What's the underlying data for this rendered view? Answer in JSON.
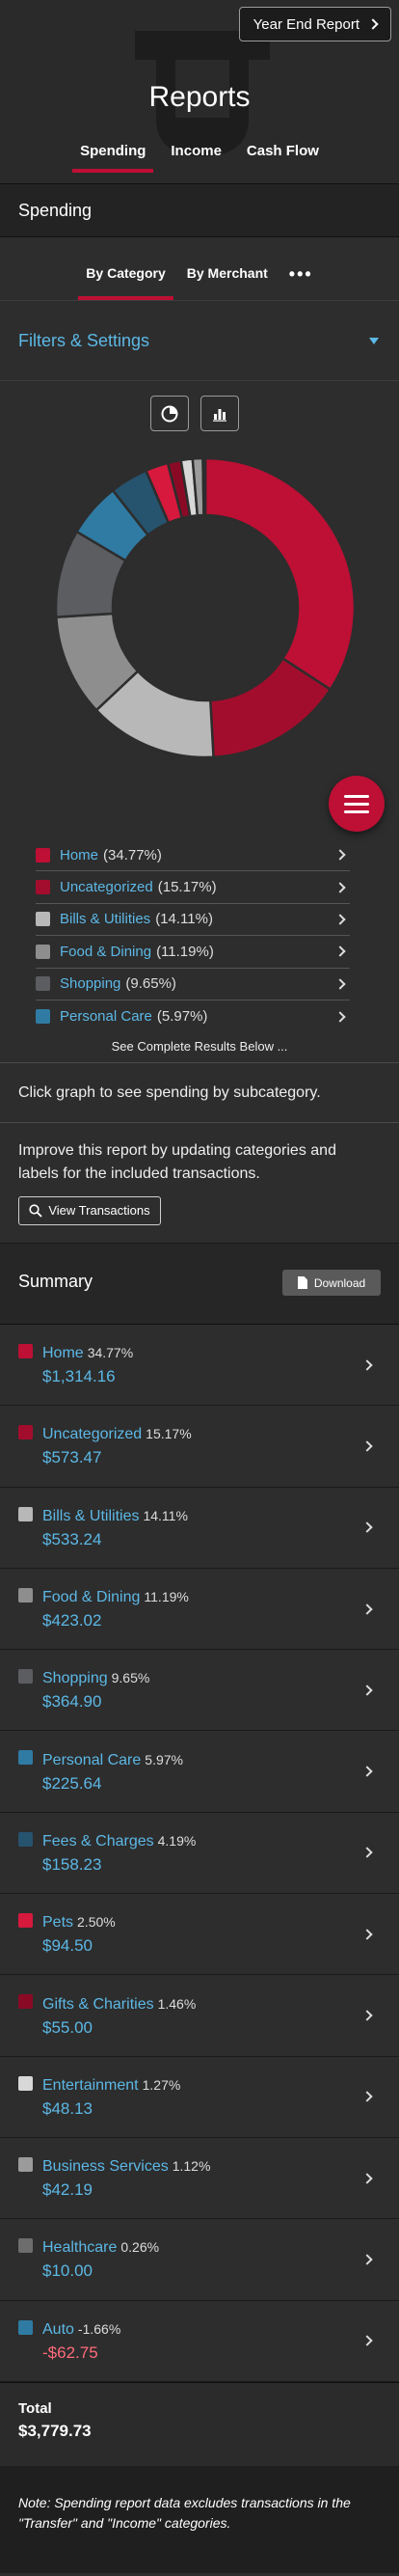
{
  "header": {
    "title": "Reports",
    "year_end_label": "Year End Report",
    "tabs": [
      {
        "label": "Spending",
        "active": true
      },
      {
        "label": "Income",
        "active": false
      },
      {
        "label": "Cash Flow",
        "active": false
      }
    ]
  },
  "spending_section": {
    "title": "Spending"
  },
  "subtabs": [
    {
      "label": "By Category",
      "active": true
    },
    {
      "label": "By Merchant",
      "active": false
    }
  ],
  "more_icon": "more-horizontal-icon",
  "filters": {
    "label": "Filters & Settings"
  },
  "chart_data": {
    "type": "pie",
    "categories": [
      "Home",
      "Uncategorized",
      "Bills & Utilities",
      "Food & Dining",
      "Shopping",
      "Personal Care",
      "Fees & Charges",
      "Pets",
      "Gifts & Charities",
      "Entertainment",
      "Business Services",
      "Healthcare"
    ],
    "values": [
      34.77,
      15.17,
      14.11,
      11.19,
      9.65,
      5.97,
      4.19,
      2.5,
      1.46,
      1.27,
      1.12,
      0.26
    ],
    "colors": [
      "#be0f34",
      "#a30d2d",
      "#b8b8b8",
      "#8e8e8e",
      "#5c5d61",
      "#2f7ba3",
      "#26536e",
      "#d6193d",
      "#8a0a26",
      "#d8d8d8",
      "#9b9b9b",
      "#6d6d6d"
    ]
  },
  "legend": [
    {
      "name": "Home",
      "pct": "(34.77%)",
      "color": "#be0f34"
    },
    {
      "name": "Uncategorized",
      "pct": "(15.17%)",
      "color": "#a30d2d"
    },
    {
      "name": "Bills & Utilities",
      "pct": "(14.11%)",
      "color": "#b8b8b8"
    },
    {
      "name": "Food & Dining",
      "pct": "(11.19%)",
      "color": "#8e8e8e"
    },
    {
      "name": "Shopping",
      "pct": "(9.65%)",
      "color": "#5c5d61"
    },
    {
      "name": "Personal Care",
      "pct": "(5.97%)",
      "color": "#2f7ba3"
    }
  ],
  "see_all": "See Complete Results Below ...",
  "click_hint": "Click graph to see spending by subcategory.",
  "improve_text": "Improve this report by updating categories and labels for the included transactions.",
  "view_transactions_label": "View Transactions",
  "summary": {
    "title": "Summary",
    "download_label": "Download",
    "rows": [
      {
        "name": "Home",
        "pct": "34.77%",
        "amount": "$1,314.16",
        "color": "#be0f34",
        "negative": false
      },
      {
        "name": "Uncategorized",
        "pct": "15.17%",
        "amount": "$573.47",
        "color": "#a30d2d",
        "negative": false
      },
      {
        "name": "Bills & Utilities",
        "pct": "14.11%",
        "amount": "$533.24",
        "color": "#b8b8b8",
        "negative": false
      },
      {
        "name": "Food & Dining",
        "pct": "11.19%",
        "amount": "$423.02",
        "color": "#8e8e8e",
        "negative": false
      },
      {
        "name": "Shopping",
        "pct": "9.65%",
        "amount": "$364.90",
        "color": "#5c5d61",
        "negative": false
      },
      {
        "name": "Personal Care",
        "pct": "5.97%",
        "amount": "$225.64",
        "color": "#2f7ba3",
        "negative": false
      },
      {
        "name": "Fees & Charges",
        "pct": "4.19%",
        "amount": "$158.23",
        "color": "#26536e",
        "negative": false
      },
      {
        "name": "Pets",
        "pct": "2.50%",
        "amount": "$94.50",
        "color": "#d6193d",
        "negative": false
      },
      {
        "name": "Gifts & Charities",
        "pct": "1.46%",
        "amount": "$55.00",
        "color": "#8a0a26",
        "negative": false
      },
      {
        "name": "Entertainment",
        "pct": "1.27%",
        "amount": "$48.13",
        "color": "#d8d8d8",
        "negative": false
      },
      {
        "name": "Business Services",
        "pct": "1.12%",
        "amount": "$42.19",
        "color": "#9b9b9b",
        "negative": false
      },
      {
        "name": "Healthcare",
        "pct": "0.26%",
        "amount": "$10.00",
        "color": "#6d6d6d",
        "negative": false
      },
      {
        "name": "Auto",
        "pct": "-1.66%",
        "amount": "-$62.75",
        "color": "#2f7ba3",
        "negative": true
      }
    ],
    "total_label": "Total",
    "total_value": "$3,779.73"
  },
  "note": "Note: Spending report data excludes transactions in the \"Transfer\" and \"Income\" categories."
}
